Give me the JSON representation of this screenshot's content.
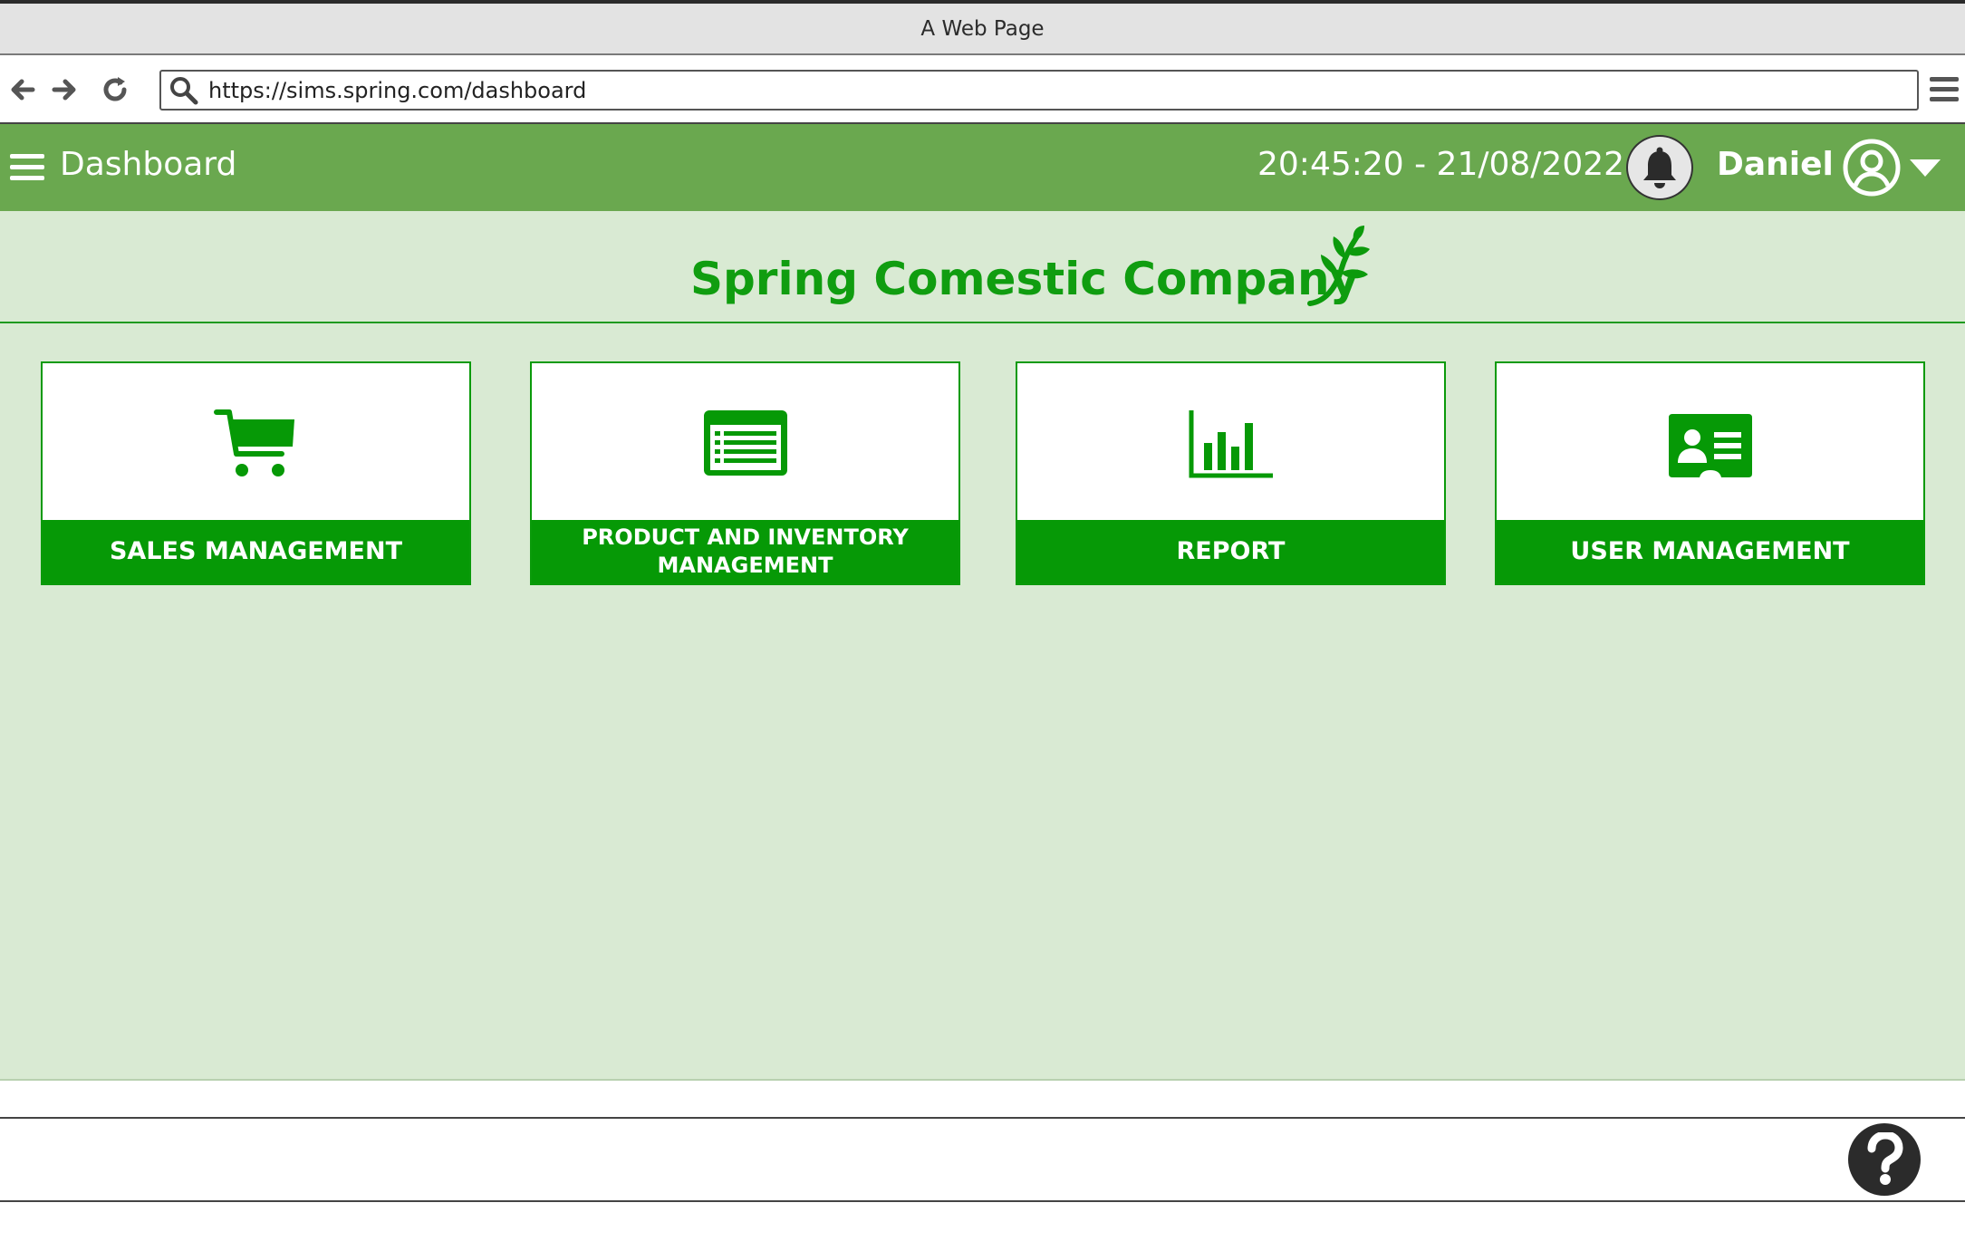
{
  "browser": {
    "window_title": "A Web Page",
    "url": "https://sims.spring.com/dashboard"
  },
  "header": {
    "title": "Dashboard",
    "datetime": "20:45:20 - 21/08/2022",
    "username": "Daniel"
  },
  "company": {
    "name": "Spring Comestic Company"
  },
  "cards": [
    {
      "label": "SALES MANAGEMENT",
      "icon": "shopping-cart-icon"
    },
    {
      "label": "PRODUCT AND INVENTORY MANAGEMENT",
      "icon": "product-list-icon"
    },
    {
      "label": "REPORT",
      "icon": "bar-chart-icon"
    },
    {
      "label": "USER MANAGEMENT",
      "icon": "user-id-card-icon"
    }
  ],
  "colors": {
    "header_green": "#6aa84f",
    "content_background": "#d9ead3",
    "accent_green": "#069906",
    "company_text": "#109d10"
  }
}
